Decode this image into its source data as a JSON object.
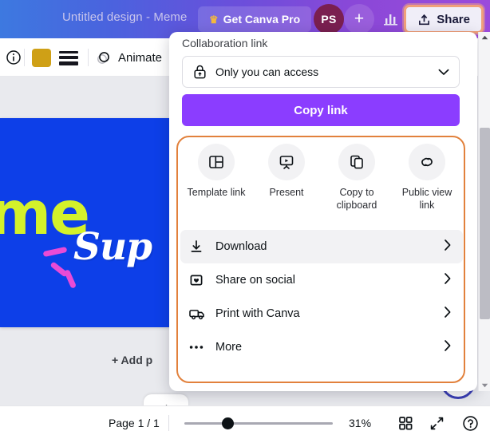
{
  "header": {
    "doc_title": "Untitled design - Meme",
    "pro_button": "Get Canva Pro",
    "crown_icon": "crown-icon",
    "avatar_initials": "PS",
    "add_collaborator": "+",
    "stats_icon": "bar-chart-icon",
    "share_button": "Share",
    "share_icon": "upload-share-icon",
    "share_highlight_color": "#f0a07a",
    "gradient_from": "#3d79e0",
    "gradient_to": "#9b4bdb"
  },
  "toolbar": {
    "info_icon": "info-icon",
    "color_swatch": "#cfa016",
    "lines_icon": "text-spacing-icon",
    "animate_label": "Animate",
    "animate_icon": "animate-circles-icon",
    "notification_dot_color": "#8b3dff"
  },
  "canvas": {
    "background": "#0d3fe8",
    "text_primary": "me",
    "text_secondary": "Sup",
    "lime_color": "#d4f12a",
    "accent_color": "#e94bd6",
    "add_page_label": "+ Add p",
    "collapse_icon": "chevron-up-icon"
  },
  "share_panel": {
    "collaboration_label": "Collaboration link",
    "access_value": "Only you can access",
    "access_icon": "lock-icon",
    "access_chevron": "chevron-down-icon",
    "copy_link_label": "Copy link",
    "copy_link_color": "#8b3dff",
    "highlight_border_color": "#e2813c",
    "quick_actions": [
      {
        "label": "Template link",
        "icon": "template-layout-icon"
      },
      {
        "label": "Present",
        "icon": "present-screen-icon"
      },
      {
        "label": "Copy to clipboard",
        "icon": "copy-icon"
      },
      {
        "label": "Public view link",
        "icon": "link-chain-icon"
      }
    ],
    "menu_items": [
      {
        "label": "Download",
        "icon": "download-icon",
        "hovered": true
      },
      {
        "label": "Share on social",
        "icon": "heart-square-icon",
        "hovered": false
      },
      {
        "label": "Print with Canva",
        "icon": "delivery-truck-icon",
        "hovered": false
      },
      {
        "label": "More",
        "icon": "ellipsis-icon",
        "hovered": false
      }
    ],
    "chevron_icon": "chevron-right-icon"
  },
  "statusbar": {
    "page_label": "Page 1 / 1",
    "zoom_percent": "31%",
    "grid_icon": "grid-view-icon",
    "fullscreen_icon": "expand-arrows-icon",
    "help_icon": "question-mark-icon"
  }
}
